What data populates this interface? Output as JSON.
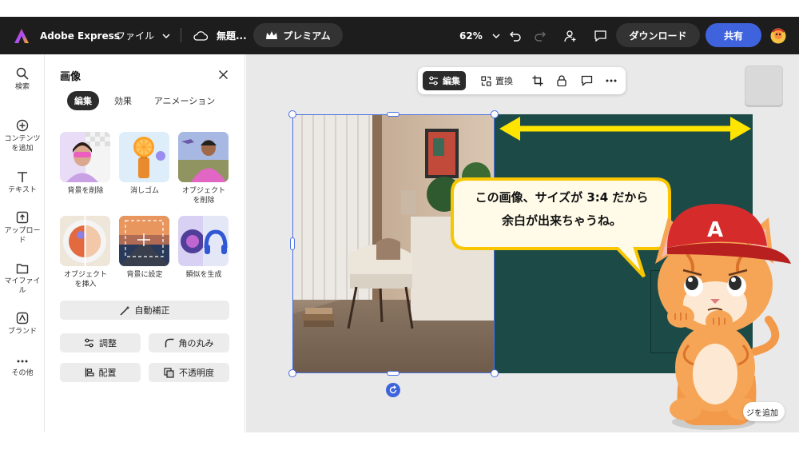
{
  "app": {
    "name": "Adobe Express",
    "menu_file": "ファイル",
    "doc_title": "無題...",
    "premium": "プレミアム",
    "zoom": "62%",
    "download": "ダウンロード",
    "share": "共有"
  },
  "rail": {
    "items": [
      {
        "label": "検索"
      },
      {
        "label": "コンテンツ\nを追加"
      },
      {
        "label": "テキスト"
      },
      {
        "label": "アップロー\nド"
      },
      {
        "label": "マイファイ\nル"
      },
      {
        "label": "ブランド"
      },
      {
        "label": "その他"
      }
    ]
  },
  "panel": {
    "title": "画像",
    "tabs": [
      {
        "label": "編集"
      },
      {
        "label": "効果"
      },
      {
        "label": "アニメーション"
      }
    ],
    "tools": [
      {
        "label": "背景を削除"
      },
      {
        "label": "消しゴム"
      },
      {
        "label": "オブジェクト\nを削除"
      },
      {
        "label": "オブジェクト\nを挿入"
      },
      {
        "label": "背景に設定"
      },
      {
        "label": "類似を生成"
      }
    ],
    "auto_fix": "自動補正",
    "adjust": "調整",
    "corner_radius": "角の丸み",
    "arrange": "配置",
    "opacity": "不透明度"
  },
  "toolbar": {
    "edit": "編集",
    "replace": "置換"
  },
  "bubble": {
    "line1": "この画像、サイズが 3:4 だから",
    "line2": "余白が出来ちゃうね。"
  },
  "add_page": "ジを追加",
  "colors": {
    "topbar": "#1d1d1d",
    "accent": "#3e63dd",
    "canvas_bg": "#1c4b47",
    "arrow": "#ffe400",
    "bubble_border": "#f7c600"
  }
}
